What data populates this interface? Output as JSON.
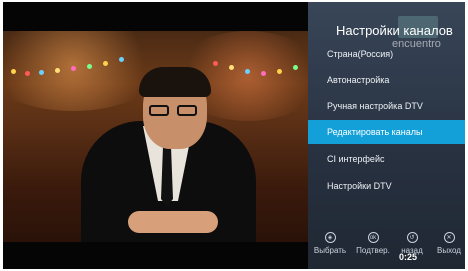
{
  "menu": {
    "title": "Настройки каналов",
    "background_text": "encuentro",
    "items": [
      {
        "label": "Страна(Россия)"
      },
      {
        "label": "Автонастройка"
      },
      {
        "label": "Ручная настройка DTV"
      },
      {
        "label": "Редактировать каналы",
        "active": true
      },
      {
        "label": "CI интерфейс"
      },
      {
        "label": "Настройки DTV"
      }
    ],
    "accent_color": "#13a0d8"
  },
  "hints": [
    {
      "label": "Выбрать",
      "icon": "select-icon"
    },
    {
      "label": "Подтвер.",
      "icon": "ok-icon"
    },
    {
      "label": "назад",
      "icon": "back-icon"
    },
    {
      "label": "Выход",
      "icon": "exit-icon"
    }
  ],
  "timer": "0:25"
}
